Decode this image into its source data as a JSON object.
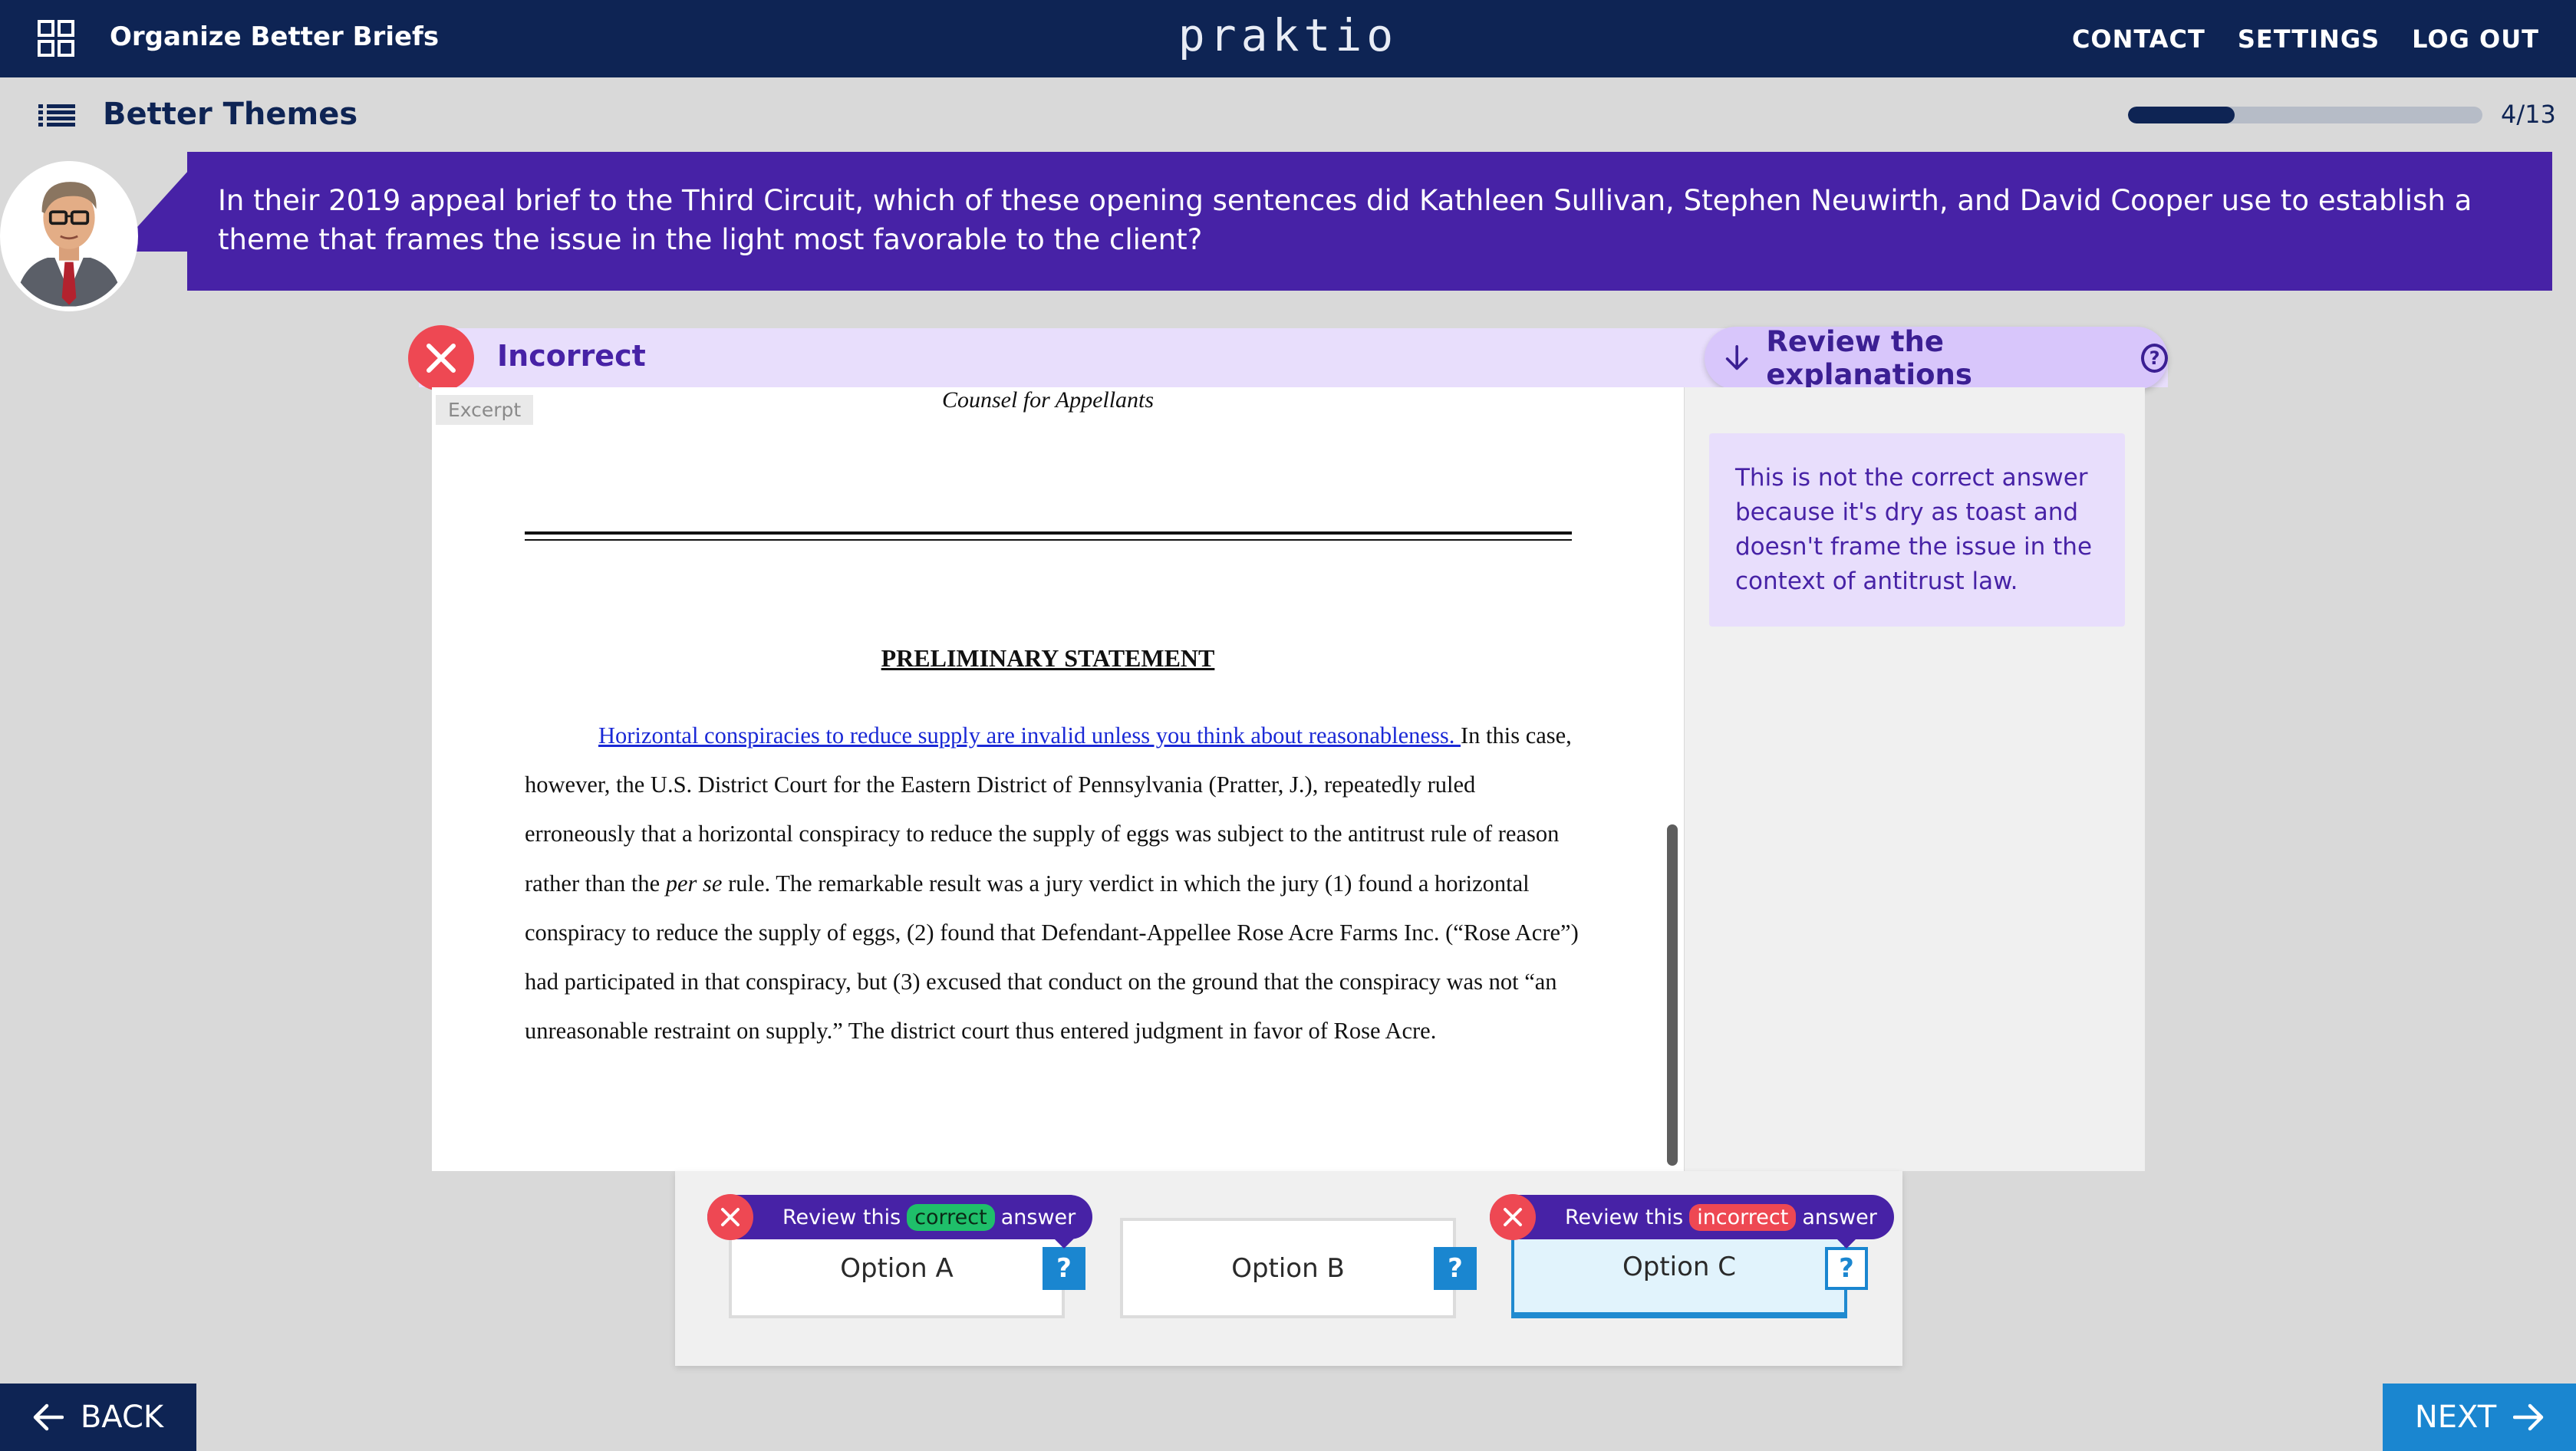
{
  "header": {
    "course_title": "Organize Better Briefs",
    "logo": "praktio",
    "nav": [
      "CONTACT",
      "SETTINGS",
      "LOG OUT"
    ]
  },
  "lesson": {
    "title": "Better Themes",
    "progress_label": "4/13",
    "progress_fraction": 0.3
  },
  "question": {
    "text": "In their 2019 appeal brief to the Third Circuit, which of these opening sentences did Kathleen Sullivan, Stephen Neuwirth, and David Cooper use to establish a theme that frames the issue in the light most favorable to the client?"
  },
  "result": {
    "status": "Incorrect",
    "review_button": "Review the explanations"
  },
  "excerpt": {
    "tag": "Excerpt",
    "counsel": "Counsel for Appellants",
    "heading": "PRELIMINARY STATEMENT",
    "highlight": "Horizontal conspiracies to reduce supply are invalid unless you think about reasonableness. ",
    "body_1": "In this case, however, the U.S. District Court for the Eastern District of Pennsylvania (Pratter, J.), repeatedly ruled erroneously that a horizontal conspiracy to reduce the supply of eggs was subject to the antitrust rule of reason rather than the ",
    "body_italic": "per se",
    "body_2": " rule. The remarkable result was a jury verdict in which the jury (1) found a horizontal conspiracy to reduce the supply of eggs, (2) found that Defendant-Appellee Rose Acre Farms Inc. (“Rose Acre”) had participated in that conspiracy, but (3) excused that conduct on the ground that the conspiracy was not “an unreasonable restraint on supply.” The district court thus entered judgment in favor of Rose Acre."
  },
  "explanation": {
    "text": "This is not the correct answer because it's dry as toast and doesn't frame the issue in the context of antitrust law."
  },
  "options": [
    {
      "label": "Option A",
      "tag_prefix": "Review this",
      "tag_pill": "correct",
      "tag_suffix": "answer"
    },
    {
      "label": "Option B"
    },
    {
      "label": "Option C",
      "tag_prefix": "Review this",
      "tag_pill": "incorrect",
      "tag_suffix": "answer"
    }
  ],
  "help_glyph": "?",
  "footer": {
    "back": "BACK",
    "next": "NEXT"
  },
  "colors": {
    "navy": "#0e2454",
    "purple": "#4722a6",
    "lavender": "#e8defc",
    "error_red": "#ee4853",
    "correct_green": "#1fbf6a",
    "action_blue": "#1a86d0"
  },
  "icons": {
    "grid": "grid-icon",
    "list": "list-icon",
    "close": "close-icon",
    "arrow_down": "arrow-down-icon",
    "help": "help-circle-icon",
    "arrow_left": "arrow-left-icon",
    "arrow_right": "arrow-right-icon"
  }
}
